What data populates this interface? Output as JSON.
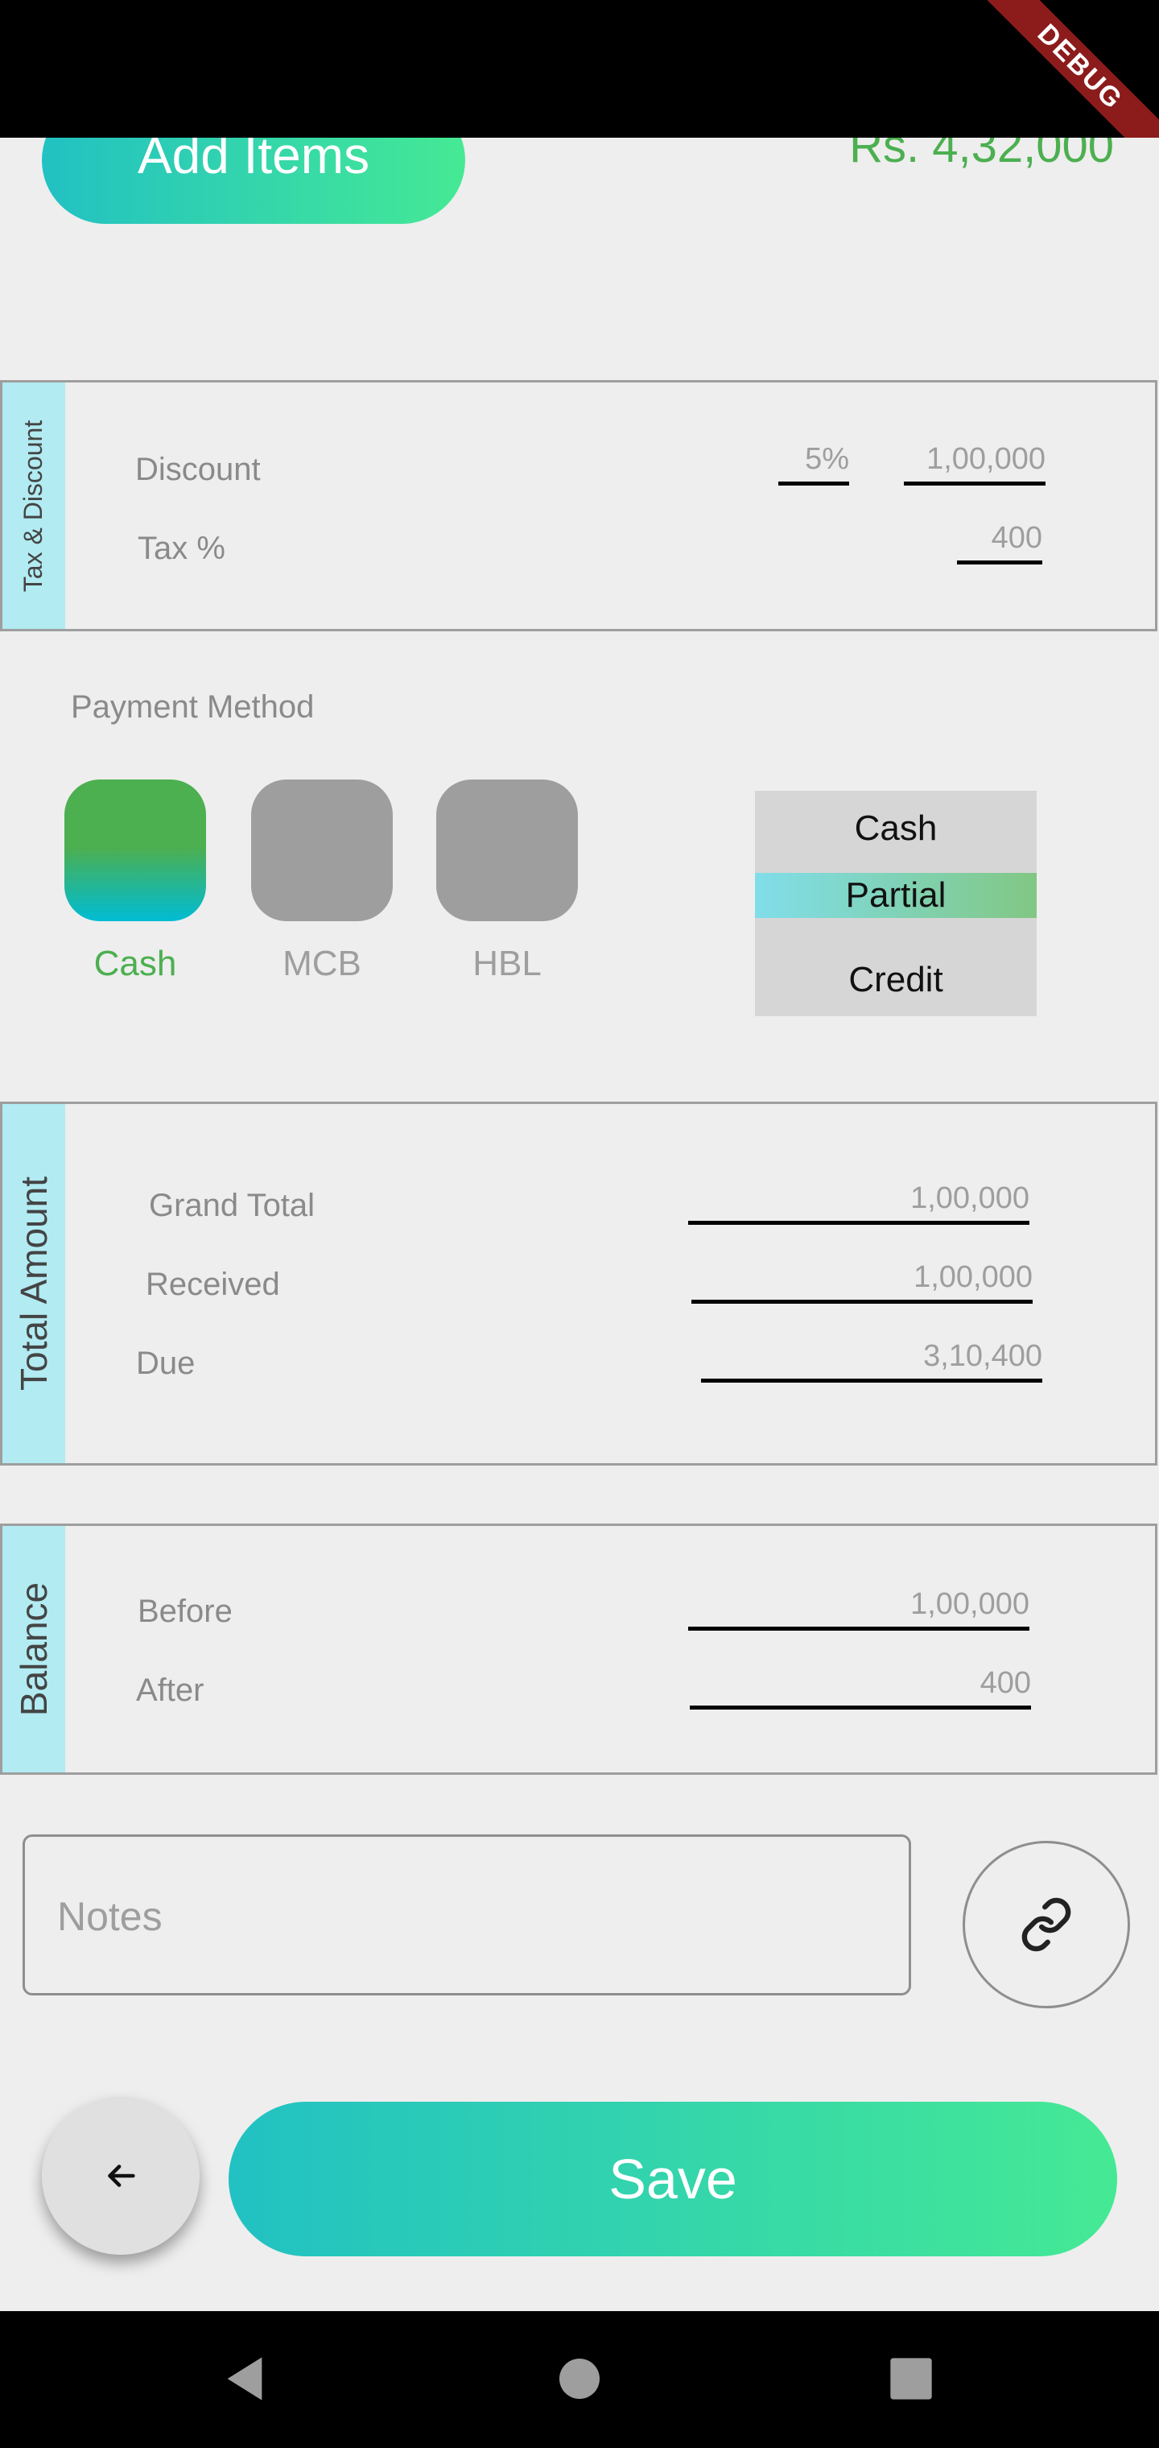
{
  "debug_banner": "DEBUG",
  "header": {
    "add_items_label": "Add Items",
    "total_amount": "Rs. 4,32,000"
  },
  "tax_discount": {
    "section_title": "Tax & Discount",
    "discount_label": "Discount",
    "discount_percent": "5%",
    "discount_amount": "1,00,000",
    "tax_label": "Tax %",
    "tax_value": "400"
  },
  "payment": {
    "label": "Payment Method",
    "methods": [
      {
        "name": "Cash",
        "selected": true
      },
      {
        "name": "MCB",
        "selected": false
      },
      {
        "name": "HBL",
        "selected": false
      }
    ],
    "type_options": [
      "Cash",
      "Partial",
      "Credit"
    ],
    "selected_type": "Partial"
  },
  "total_amount": {
    "section_title": "Total Amount",
    "grand_total_label": "Grand Total",
    "grand_total": "1,00,000",
    "received_label": "Received",
    "received": "1,00,000",
    "due_label": "Due",
    "due": "3,10,400"
  },
  "balance": {
    "section_title": "Balance",
    "before_label": "Before",
    "before": "1,00,000",
    "after_label": "After",
    "after": "400"
  },
  "notes": {
    "placeholder": "Notes"
  },
  "footer": {
    "save_label": "Save"
  },
  "icons": {
    "attach": "link-icon",
    "back": "arrow-back-icon"
  },
  "colors": {
    "accent_green": "#4caf50",
    "gradient_start": "#22c1c3",
    "gradient_end": "#45e994",
    "tab_bg": "#b2ebf2"
  }
}
